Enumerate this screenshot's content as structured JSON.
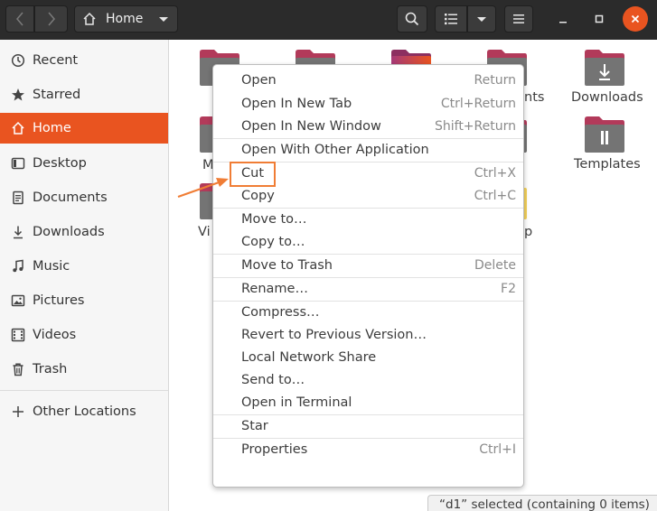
{
  "header": {
    "location_label": "Home"
  },
  "sidebar": {
    "items": [
      {
        "label": "Recent",
        "icon": "clock-icon"
      },
      {
        "label": "Starred",
        "icon": "star-icon"
      },
      {
        "label": "Home",
        "icon": "home-icon",
        "active": true
      },
      {
        "label": "Desktop",
        "icon": "desktop-icon"
      },
      {
        "label": "Documents",
        "icon": "document-icon"
      },
      {
        "label": "Downloads",
        "icon": "download-icon"
      },
      {
        "label": "Music",
        "icon": "music-icon"
      },
      {
        "label": "Pictures",
        "icon": "picture-icon"
      },
      {
        "label": "Videos",
        "icon": "video-icon"
      },
      {
        "label": "Trash",
        "icon": "trash-icon"
      }
    ],
    "other_locations": {
      "label": "Other Locations",
      "icon": "plus-icon"
    }
  },
  "folders": {
    "documents_partial": "nts",
    "downloads": "Downloads",
    "templates": "Templates",
    "music_partial": "M",
    "videos_partial": "Vi",
    "desktop_partial": "p"
  },
  "context_menu": {
    "items": [
      {
        "label": "Open",
        "accel": "Return"
      },
      {
        "label": "Open In New Tab",
        "accel": "Ctrl+Return"
      },
      {
        "label": "Open In New Window",
        "accel": "Shift+Return"
      },
      {
        "label": "Open With Other Application",
        "accel": ""
      },
      {
        "label": "Cut",
        "accel": "Ctrl+X"
      },
      {
        "label": "Copy",
        "accel": "Ctrl+C"
      },
      {
        "label": "Move to…",
        "accel": ""
      },
      {
        "label": "Copy to…",
        "accel": ""
      },
      {
        "label": "Move to Trash",
        "accel": "Delete"
      },
      {
        "label": "Rename…",
        "accel": "F2"
      },
      {
        "label": "Compress…",
        "accel": ""
      },
      {
        "label": "Revert to Previous Version…",
        "accel": ""
      },
      {
        "label": "Local Network Share",
        "accel": ""
      },
      {
        "label": "Send to…",
        "accel": ""
      },
      {
        "label": "Open in Terminal",
        "accel": ""
      },
      {
        "label": "Star",
        "accel": ""
      },
      {
        "label": "Properties",
        "accel": "Ctrl+I"
      }
    ]
  },
  "status_bar": {
    "text": "“d1” selected  (containing 0 items)"
  },
  "colors": {
    "accent": "#e95420",
    "highlight": "#f07d35",
    "folder_tab": "#b23a5a",
    "folder_body": "#747474"
  }
}
